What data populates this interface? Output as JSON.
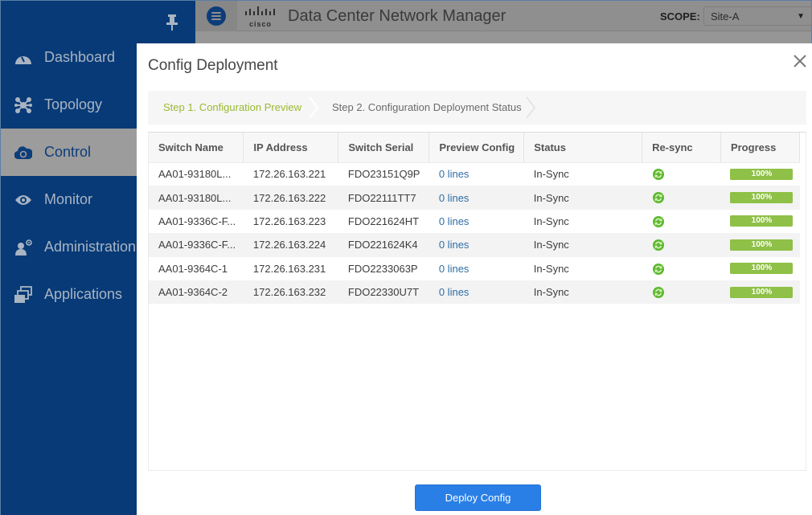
{
  "app": {
    "brand": "cisco",
    "title": "Data Center Network Manager",
    "scope_label": "SCOPE:",
    "scope_value": "Site-A"
  },
  "sidebar": {
    "items": [
      {
        "label": "Dashboard",
        "icon": "dashboard-gauge-icon",
        "active": false
      },
      {
        "label": "Topology",
        "icon": "topology-icon",
        "active": false
      },
      {
        "label": "Control",
        "icon": "control-cloud-icon",
        "active": true
      },
      {
        "label": "Monitor",
        "icon": "eye-icon",
        "active": false
      },
      {
        "label": "Administration",
        "icon": "admin-user-gear-icon",
        "active": false
      },
      {
        "label": "Applications",
        "icon": "applications-windows-icon",
        "active": false
      }
    ]
  },
  "modal": {
    "title": "Config Deployment",
    "steps": [
      {
        "label": "Step 1. Configuration Preview",
        "active": true
      },
      {
        "label": "Step 2. Configuration Deployment Status",
        "active": false
      }
    ],
    "table": {
      "columns": [
        "Switch Name",
        "IP Address",
        "Switch Serial",
        "Preview Config",
        "Status",
        "Re-sync",
        "Progress"
      ],
      "rows": [
        {
          "name": "AA01-93180L...",
          "ip": "172.26.163.221",
          "serial": "FDO23151Q9P",
          "preview": "0 lines",
          "status": "In-Sync",
          "progress": 100,
          "progress_label": "100%"
        },
        {
          "name": "AA01-93180L...",
          "ip": "172.26.163.222",
          "serial": "FDO22111TT7",
          "preview": "0 lines",
          "status": "In-Sync",
          "progress": 100,
          "progress_label": "100%"
        },
        {
          "name": "AA01-9336C-F...",
          "ip": "172.26.163.223",
          "serial": "FDO221624HT",
          "preview": "0 lines",
          "status": "In-Sync",
          "progress": 100,
          "progress_label": "100%"
        },
        {
          "name": "AA01-9336C-F...",
          "ip": "172.26.163.224",
          "serial": "FDO221624K4",
          "preview": "0 lines",
          "status": "In-Sync",
          "progress": 100,
          "progress_label": "100%"
        },
        {
          "name": "AA01-9364C-1",
          "ip": "172.26.163.231",
          "serial": "FDO2233063P",
          "preview": "0 lines",
          "status": "In-Sync",
          "progress": 100,
          "progress_label": "100%"
        },
        {
          "name": "AA01-9364C-2",
          "ip": "172.26.163.232",
          "serial": "FDO22330U7T",
          "preview": "0 lines",
          "status": "In-Sync",
          "progress": 100,
          "progress_label": "100%"
        }
      ]
    },
    "deploy_button": "Deploy Config"
  },
  "colors": {
    "sidebar_bg": "#073a77",
    "step_active": "#9ab930",
    "link": "#2f6ea5",
    "progress": "#8fc047",
    "primary_button": "#2a7fe6"
  }
}
